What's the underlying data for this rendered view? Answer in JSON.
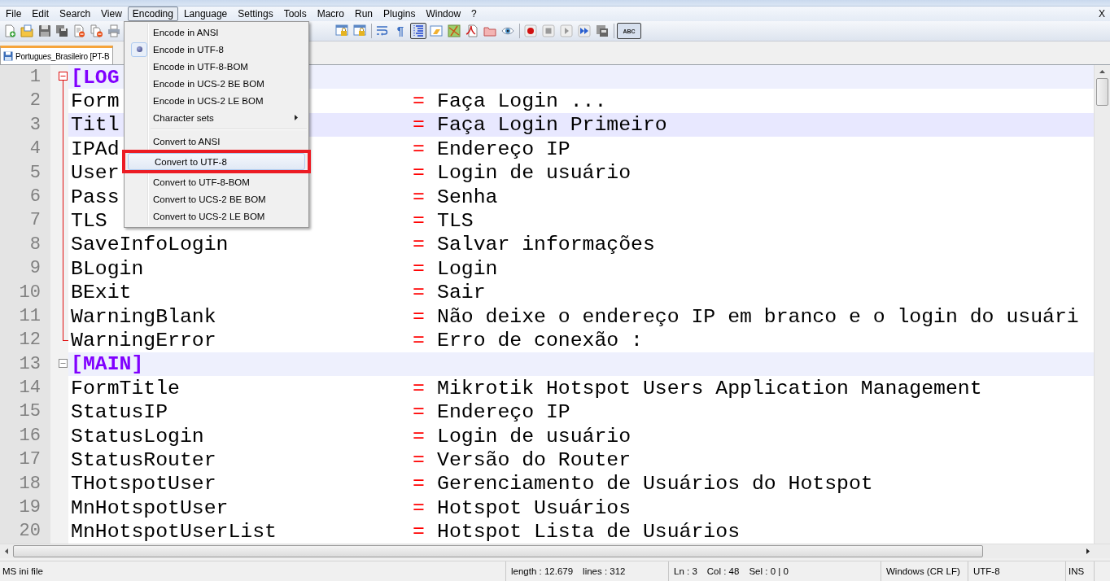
{
  "menu_bar": {
    "items": [
      {
        "label": "File",
        "selected": false
      },
      {
        "label": "Edit",
        "selected": false
      },
      {
        "label": "Search",
        "selected": false
      },
      {
        "label": "View",
        "selected": false
      },
      {
        "label": "Encoding",
        "selected": true
      },
      {
        "label": "Language",
        "selected": false
      },
      {
        "label": "Settings",
        "selected": false
      },
      {
        "label": "Tools",
        "selected": false
      },
      {
        "label": "Macro",
        "selected": false
      },
      {
        "label": "Run",
        "selected": false
      },
      {
        "label": "Plugins",
        "selected": false
      },
      {
        "label": "Window",
        "selected": false
      },
      {
        "label": "?",
        "selected": false
      }
    ],
    "close_label": "X"
  },
  "toolbar_groups": [
    [
      {
        "kind": "button",
        "pressed": false
      },
      {
        "kind": "button",
        "pressed": false
      },
      {
        "kind": "button",
        "pressed": false
      },
      {
        "kind": "button",
        "pressed": false
      },
      {
        "kind": "button",
        "pressed": false
      },
      {
        "kind": "button",
        "pressed": false
      },
      {
        "kind": "button",
        "pressed": false
      }
    ],
    [
      {
        "kind": "button",
        "pressed": false
      },
      {
        "kind": "button",
        "pressed": false
      },
      {
        "kind": "separator"
      },
      {
        "kind": "button",
        "pressed": false
      },
      {
        "kind": "button",
        "pressed": false,
        "label": "¶"
      },
      {
        "kind": "button",
        "pressed": true
      },
      {
        "kind": "button",
        "pressed": false
      },
      {
        "kind": "button",
        "pressed": false
      },
      {
        "kind": "button",
        "pressed": false
      },
      {
        "kind": "button",
        "pressed": false
      },
      {
        "kind": "button",
        "pressed": false
      },
      {
        "kind": "separator"
      },
      {
        "kind": "button",
        "pressed": false
      },
      {
        "kind": "button",
        "pressed": false
      },
      {
        "kind": "button",
        "pressed": false
      },
      {
        "kind": "button",
        "pressed": false
      },
      {
        "kind": "button",
        "pressed": false
      },
      {
        "kind": "separator"
      },
      {
        "kind": "button",
        "pressed": true,
        "label": "ABC"
      }
    ]
  ],
  "tabs": [
    {
      "label": "Portugues_Brasileiro [PT-B",
      "selected": true
    }
  ],
  "ini_sign": "=",
  "editor": {
    "sections": [
      {
        "line": "1",
        "header": "[LOG",
        "active": true,
        "children": [
          {
            "line": "2",
            "key": "Form",
            "value": "Faça Login ...",
            "current": false
          },
          {
            "line": "3",
            "key": "Titl",
            "value": "Faça Login Primeiro",
            "current": true
          },
          {
            "line": "4",
            "key": "IPAd",
            "value": "Endereço IP",
            "current": false
          },
          {
            "line": "5",
            "key": "User",
            "value": "Login de usuário",
            "current": false
          },
          {
            "line": "6",
            "key": "Pass",
            "value": "Senha",
            "current": false
          },
          {
            "line": "7",
            "key": "TLS",
            "value": "TLS",
            "current": false
          },
          {
            "line": "8",
            "key": "SaveInfoLogin",
            "value": "Salvar informações",
            "current": false
          },
          {
            "line": "9",
            "key": "BLogin",
            "value": "Login",
            "current": false
          },
          {
            "line": "10",
            "key": "BExit",
            "value": "Sair",
            "current": false
          },
          {
            "line": "11",
            "key": "WarningBlank",
            "value": "Não deixe o endereço IP em branco e o login do usuári",
            "current": false
          },
          {
            "line": "12",
            "key": "WarningError",
            "value": "Erro de conexão :",
            "current": false
          }
        ]
      },
      {
        "line": "13",
        "header": "[MAIN]",
        "active": false,
        "children": [
          {
            "line": "14",
            "key": "FormTitle",
            "value": "Mikrotik Hotspot Users Application Management",
            "current": false
          },
          {
            "line": "15",
            "key": "StatusIP",
            "value": "Endereço IP",
            "current": false
          },
          {
            "line": "16",
            "key": "StatusLogin",
            "value": "Login de usuário",
            "current": false
          },
          {
            "line": "17",
            "key": "StatusRouter",
            "value": "Versão do Router",
            "current": false
          },
          {
            "line": "18",
            "key": "THotspotUser",
            "value": "Gerenciamento de Usuários do Hotspot",
            "current": false
          },
          {
            "line": "19",
            "key": "MnHotspotUser",
            "value": "Hotspot Usuários",
            "current": false
          },
          {
            "line": "20",
            "key": "MnHotspotUserList",
            "value": "Hotspot Lista de Usuários",
            "current": false
          }
        ]
      }
    ]
  },
  "encoding_menu": {
    "items": [
      {
        "kind": "radio",
        "label": "Encode in ANSI",
        "selected": false,
        "highlighted": false,
        "annotated": false
      },
      {
        "kind": "radio",
        "label": "Encode in UTF-8",
        "selected": true,
        "highlighted": false,
        "annotated": false
      },
      {
        "kind": "radio",
        "label": "Encode in UTF-8-BOM",
        "selected": false,
        "highlighted": false,
        "annotated": false
      },
      {
        "kind": "radio",
        "label": "Encode in UCS-2 BE BOM",
        "selected": false,
        "highlighted": false,
        "annotated": false
      },
      {
        "kind": "radio",
        "label": "Encode in UCS-2 LE BOM",
        "selected": false,
        "highlighted": false,
        "annotated": false
      },
      {
        "kind": "submenu",
        "label": "Character sets",
        "highlighted": false,
        "annotated": false
      },
      {
        "kind": "separator"
      },
      {
        "kind": "command",
        "label": "Convert to ANSI",
        "highlighted": false,
        "annotated": false
      },
      {
        "kind": "command",
        "label": "Convert to UTF-8",
        "highlighted": true,
        "annotated": true
      },
      {
        "kind": "command",
        "label": "Convert to UTF-8-BOM",
        "highlighted": false,
        "annotated": false
      },
      {
        "kind": "command",
        "label": "Convert to UCS-2 BE BOM",
        "highlighted": false,
        "annotated": false
      },
      {
        "kind": "command",
        "label": "Convert to UCS-2 LE BOM",
        "highlighted": false,
        "annotated": false
      }
    ]
  },
  "status_bar": [
    {
      "texts": [
        "MS ini file"
      ]
    },
    {
      "texts": [
        "length : 12.679",
        "lines : 312"
      ]
    },
    {
      "texts": [
        "Ln : 3",
        "Col : 48",
        "Sel : 0 | 0"
      ]
    },
    {
      "texts": [
        "Windows (CR LF)"
      ]
    },
    {
      "texts": [
        "UTF-8"
      ]
    },
    {
      "texts": [
        "INS"
      ]
    }
  ]
}
